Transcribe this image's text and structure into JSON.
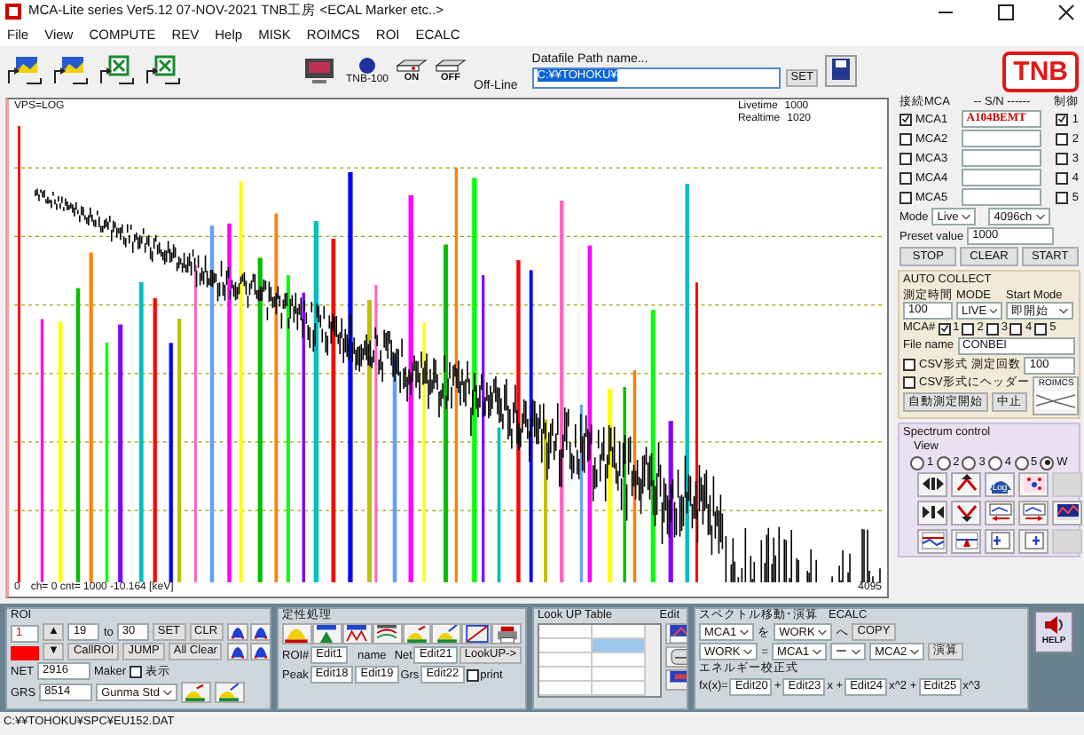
{
  "window": {
    "title": "MCA-Lite series  Ver5.12  07-NOV-2021 TNB工房  <ECAL Marker etc..>"
  },
  "menu": [
    "File",
    "View",
    "COMPUTE",
    "REV",
    "Help",
    "MISK",
    "ROIMCS",
    "ROI",
    "ECALC"
  ],
  "toolbar": {
    "device_label": "TNB-100",
    "on_label": "ON",
    "off_label": "OFF",
    "status": "Off-Line",
    "path_label": "Datafile Path name...",
    "path_value": "C:¥¥TOHOKU¥",
    "set_button": "SET",
    "logo": "TNB"
  },
  "spectrum": {
    "mode": "VPS=LOG",
    "livetime_label": "Livetime",
    "livetime": "1000",
    "realtime_label": "Realtime",
    "realtime": "1020",
    "x_start": "0",
    "readout": "ch=    0     cnt=     1000     -10.164 [keV]",
    "x_end": "4095"
  },
  "mca_panel": {
    "connect_label": "接続MCA",
    "sn_label": "-- S/N ------",
    "control_label": "制御",
    "rows": [
      {
        "label": "MCA1",
        "checked": true,
        "serial": "A104BEMT",
        "control": "1",
        "control_checked": true
      },
      {
        "label": "MCA2",
        "checked": false,
        "control": "2",
        "control_checked": false
      },
      {
        "label": "MCA3",
        "checked": false,
        "control": "3",
        "control_checked": false
      },
      {
        "label": "MCA4",
        "checked": false,
        "control": "4",
        "control_checked": false
      },
      {
        "label": "MCA5",
        "checked": false,
        "control": "5",
        "control_checked": false
      }
    ],
    "mode_label": "Mode",
    "mode": "Live",
    "channels": "4096ch",
    "preset_label": "Preset value",
    "preset": "1000",
    "buttons": [
      "STOP",
      "CLEAR",
      "START"
    ]
  },
  "auto_collect": {
    "title": "AUTO COLLECT",
    "time_label": "測定時間",
    "time": "100",
    "mode_label": "MODE",
    "mode": "LIVE",
    "start_label": "Start Mode",
    "start": "即開始",
    "mca_label": "MCA#",
    "mca": [
      {
        "label": "1",
        "checked": true
      },
      {
        "label": "2",
        "checked": false
      },
      {
        "label": "3",
        "checked": false
      },
      {
        "label": "4",
        "checked": false
      },
      {
        "label": "5",
        "checked": false
      }
    ],
    "file_label": "File name",
    "file": "CONBEI",
    "csv": {
      "label": "CSV形式",
      "checked": false
    },
    "count_label": "測定回数",
    "count": "100",
    "csv_header": {
      "label": "CSV形式にヘッダー",
      "checked": false
    },
    "thumb_label": "ROIMCS",
    "buttons": [
      "自動測定開始",
      "中止"
    ]
  },
  "spectrum_control": {
    "title": "Spectrum control",
    "view_label": "View",
    "views": [
      {
        "label": "1",
        "selected": false
      },
      {
        "label": "2",
        "selected": false
      },
      {
        "label": "3",
        "selected": false
      },
      {
        "label": "4",
        "selected": false
      },
      {
        "label": "5",
        "selected": false
      },
      {
        "label": "W",
        "selected": true
      }
    ],
    "tools": [
      {
        "kind": "expand",
        "disabled": false
      },
      {
        "kind": "peak-up",
        "disabled": false
      },
      {
        "kind": "log",
        "label": "Log",
        "disabled": false
      },
      {
        "kind": "dots",
        "disabled": false
      },
      {
        "kind": "blank",
        "disabled": true
      },
      {
        "kind": "shrink",
        "disabled": false
      },
      {
        "kind": "peak-down",
        "disabled": false
      },
      {
        "kind": "shift-left",
        "disabled": false
      },
      {
        "kind": "shift-right",
        "disabled": false
      },
      {
        "kind": "color",
        "disabled": false
      },
      {
        "kind": "lines",
        "disabled": false
      },
      {
        "kind": "marker",
        "disabled": false
      },
      {
        "kind": "cursor-left",
        "disabled": false
      },
      {
        "kind": "cursor-right",
        "disabled": false
      },
      {
        "kind": "blank",
        "disabled": true
      }
    ]
  },
  "roi": {
    "title": "ROI",
    "number": "1",
    "color": "#ff0000",
    "up": "▲",
    "down": "▼",
    "from": "19",
    "to_label": "to",
    "to": "30",
    "set_button": "SET",
    "clr_button": "CLR",
    "call_button": "CallROI",
    "jump_button": "JUMP",
    "clear_button": "All Clear",
    "net_label": "NET",
    "net": "2916",
    "grs_label": "GRS",
    "grs": "8514",
    "maker_label": "Maker",
    "show": {
      "label": "表示",
      "checked": false
    },
    "library": "Gunma Std"
  },
  "qualitative": {
    "title": "定性処理",
    "roi_label": "ROI#",
    "roi": "Edit1",
    "name_label": "name",
    "net_label": "Net",
    "net": "Edit21",
    "lookup_button": "LookUP->",
    "peak_label": "Peak",
    "peak_from": "Edit18",
    "peak_to": "Edit19",
    "grs_label": "Grs",
    "grs": "Edit22",
    "print": {
      "label": "print",
      "checked": false
    }
  },
  "lookup": {
    "title": "Look UP Table",
    "edit_label": "Edit",
    "rows": [
      {
        "selected": false
      },
      {
        "selected": true
      },
      {
        "selected": false
      },
      {
        "selected": false
      },
      {
        "selected": false
      }
    ]
  },
  "ecalc": {
    "title": "スペクトル移動･演算",
    "subtitle": "ECALC",
    "copy_source": "MCA1",
    "wo": "を",
    "copy_target": "WORK",
    "he": "へ",
    "copy_button": "COPY",
    "result": "WORK",
    "equals": "=",
    "operand1": "MCA1",
    "operator": "ー",
    "operand2": "MCA2",
    "calc_button": "演算",
    "formula_title": "エネルギー校正式",
    "fx": "fx(x)=",
    "coefs": [
      {
        "value": "Edit20",
        "suffix": "+"
      },
      {
        "value": "Edit23",
        "suffix": "x +"
      },
      {
        "value": "Edit24",
        "suffix": "x^2 +"
      },
      {
        "value": "Edit25",
        "suffix": "x^3"
      }
    ]
  },
  "help_label": "HELP",
  "status_bar": "C:¥¥TOHOKU¥SPC¥EU152.DAT"
}
